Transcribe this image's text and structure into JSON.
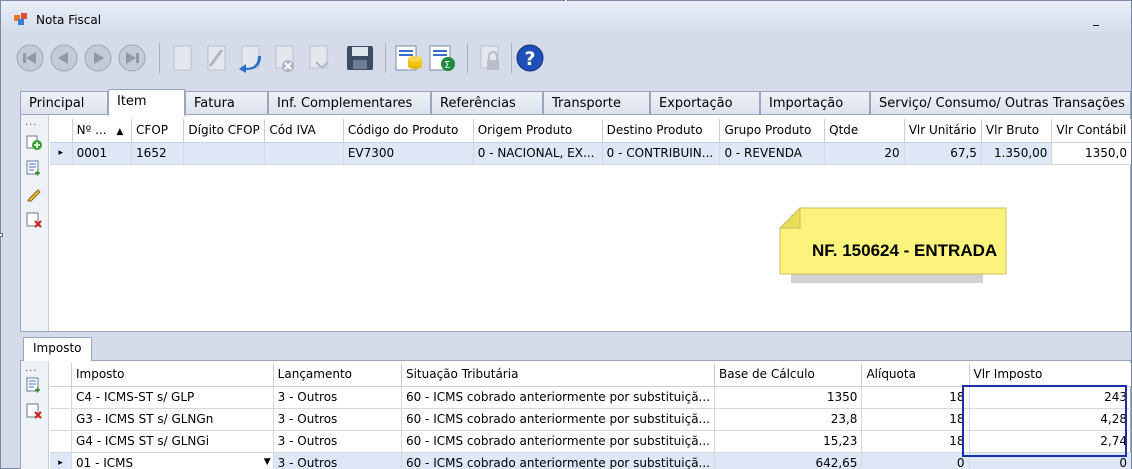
{
  "window": {
    "title": "Nota Fiscal",
    "minimize_label": "_"
  },
  "toolbar": {
    "buttons": [
      "first-record",
      "previous-record",
      "next-record",
      "last-record",
      "new-document",
      "edit-document",
      "undo",
      "cancel",
      "disabled-action",
      "save",
      "report-list",
      "export-excel",
      "lock",
      "help"
    ]
  },
  "tabs": [
    "Principal",
    "Item",
    "Fatura",
    "Inf. Complementares",
    "Referências",
    "Transporte",
    "Exportação",
    "Importação",
    "Serviço/ Consumo/ Outras Transações"
  ],
  "active_tab": "Item",
  "item_grid": {
    "dots": "...",
    "columns": [
      "Nº ...",
      "CFOP",
      "Dígito CFOP",
      "Cód IVA",
      "Código do Produto",
      "Origem Produto",
      "Destino Produto",
      "Grupo Produto",
      "Qtde",
      "Vlr Unitário",
      "Vlr Bruto",
      "Vlr Contábil"
    ],
    "sort_indicator": "▲",
    "rows": [
      {
        "indicator": "▸",
        "numero": "0001",
        "cfop": "1652",
        "digito": "",
        "cod_iva": "",
        "codigo": "EV7300",
        "origem": "0 - NACIONAL, EX...",
        "destino": "0 - CONTRIBUIN...",
        "grupo": "0 - REVENDA",
        "qtde": "20",
        "unitario": "67,5",
        "bruto": "1.350,00",
        "contabil": "1350,0"
      }
    ]
  },
  "note": {
    "text": "NF. 150624 - ENTRADA",
    "color": "#fbf37b"
  },
  "imposto_tab": "Imposto",
  "imposto_grid": {
    "dots": "...",
    "columns": [
      "Imposto",
      "Lançamento",
      "Situação Tributária",
      "Base de Cálculo",
      "Alíquota",
      "Vlr Imposto"
    ],
    "rows": [
      {
        "indicator": "",
        "imposto": "C4 - ICMS-ST s/ GLP",
        "lancamento": "3 - Outros",
        "situacao": "60 - ICMS cobrado anteriormente por substituiçã...",
        "base": "1350",
        "aliquota": "18",
        "valor": "243"
      },
      {
        "indicator": "",
        "imposto": "G3 - ICMS ST s/ GLNGn",
        "lancamento": "3 - Outros",
        "situacao": "60 - ICMS cobrado anteriormente por substituiçã...",
        "base": "23,8",
        "aliquota": "18",
        "valor": "4,28"
      },
      {
        "indicator": "",
        "imposto": "G4 - ICMS ST s/ GLNGi",
        "lancamento": "3 - Outros",
        "situacao": "60 - ICMS cobrado anteriormente por substituiçã...",
        "base": "15,23",
        "aliquota": "18",
        "valor": "2,74"
      },
      {
        "indicator": "▸",
        "imposto": "01 - ICMS",
        "lancamento": "3 - Outros",
        "situacao": "60 - ICMS cobrado anteriormente por substituiçã...",
        "base": "642,65",
        "aliquota": "0",
        "valor": "0"
      }
    ]
  },
  "colors": {
    "highlight_border": "#1c2fa8",
    "selected_row": "#dde7f5",
    "window_bg": "#d6dbe9"
  }
}
